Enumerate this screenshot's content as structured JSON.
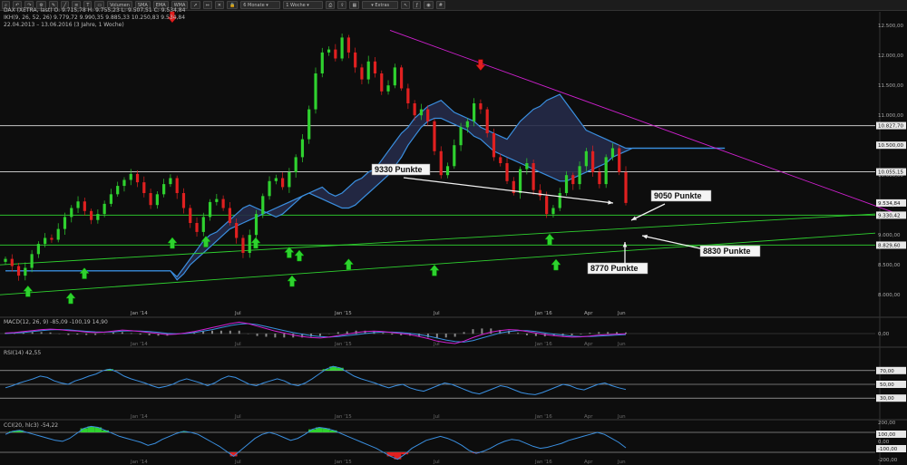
{
  "toolbar": {
    "buttons": [
      "Volumen",
      "SMA",
      "EMA",
      "WMA"
    ],
    "period_select": "6 Monate",
    "interval_select": "1 Woche",
    "extras_label": "Extras",
    "icons": [
      "zoom-icon",
      "undo-icon",
      "redo-icon",
      "settings-icon",
      "pencil-icon",
      "line-icon",
      "fib-icon",
      "text-icon",
      "shape-icon",
      "arrow-icon",
      "measure-icon",
      "delete-icon",
      "lock-icon",
      "print-icon",
      "export-icon",
      "layout-icon",
      "pointer-icon",
      "indicator-icon",
      "camera-icon",
      "grid-icon"
    ]
  },
  "info": {
    "line1": "DAX (XETRA, last)  O: 9.715,78  H: 9.755,23  L: 9.507,51  C: 9.534,84",
    "line2": "IKH(9, 26, 52, 26)  9.779,72  9.990,35  9.885,33  10.250,83  9.534,84",
    "line3": "22.04.2013 – 13.06.2016 (3 Jahre, 1 Woche)"
  },
  "colors": {
    "background": "#0d0d0d",
    "bull": "#2fd12f",
    "bear": "#e02020",
    "cloud_line": "#3a8fe0",
    "cloud_fill": "#252a48",
    "support": "#2fd12f",
    "resistance_trend": "#d020d0",
    "horizontal": "#d8d8d8",
    "macd_line": "#d020d0",
    "macd_signal": "#3a8fe0",
    "oscillator": "#3a8fe0"
  },
  "chart_data": [
    {
      "type": "candlestick",
      "title": "",
      "y_ticks": [
        8000,
        8500,
        9000,
        9500,
        10000,
        10500,
        11000,
        11500,
        12000,
        12500
      ],
      "x_ticks": [
        "Jan '14",
        "Jul",
        "Jan '15",
        "Jul",
        "Jan '16",
        "Apr",
        "Jun"
      ],
      "ylim": [
        7700,
        12700
      ],
      "price_boxes": [
        {
          "label": "10.827,70",
          "value": 10827.7
        },
        {
          "label": "10.500,00",
          "value": 10500
        },
        {
          "label": "10.055,15",
          "value": 10055.15
        },
        {
          "label": "9.534,84",
          "value": 9534.84
        },
        {
          "label": "9.330,42",
          "value": 9330.42
        },
        {
          "label": "8.829,60",
          "value": 8829.6
        }
      ],
      "horizontal_lines": [
        10827.7,
        10055.15,
        9330,
        8830
      ],
      "close_series": [
        8600,
        8480,
        8320,
        8450,
        8680,
        8850,
        8950,
        8920,
        9100,
        9300,
        9450,
        9560,
        9400,
        9250,
        9350,
        9520,
        9680,
        9820,
        9920,
        10020,
        9880,
        9700,
        9500,
        9680,
        9850,
        9950,
        9700,
        9450,
        9200,
        9050,
        9300,
        9550,
        9600,
        9450,
        9200,
        8950,
        8700,
        9000,
        9350,
        9650,
        9900,
        9950,
        9800,
        10050,
        10300,
        10600,
        11100,
        11700,
        12050,
        12100,
        11950,
        12300,
        12050,
        11800,
        11600,
        11900,
        11700,
        11400,
        11500,
        11800,
        11450,
        11200,
        11000,
        11100,
        10900,
        10400,
        10000,
        10150,
        10500,
        10800,
        10900,
        11200,
        11100,
        10700,
        10300,
        10200,
        9900,
        9700,
        10100,
        10200,
        9750,
        9650,
        9350,
        9450,
        9700,
        10000,
        9850,
        10150,
        10400,
        10050,
        9850,
        10300,
        10450,
        10050,
        9534.84
      ],
      "cloud": {
        "span_a": [
          8400,
          8400,
          8400,
          8400,
          8400,
          8400,
          8400,
          8400,
          8400,
          8400,
          8400,
          8400,
          8400,
          8400,
          8400,
          8400,
          8400,
          8400,
          8400,
          8400,
          8400,
          8400,
          8400,
          8400,
          8400,
          8400,
          8300,
          8450,
          8600,
          8750,
          8900,
          9000,
          9050,
          9150,
          9250,
          9350,
          9450,
          9500,
          9450,
          9400,
          9350,
          9300,
          9350,
          9450,
          9550,
          9650,
          9700,
          9750,
          9800,
          9700,
          9650,
          9700,
          9800,
          9900,
          9950,
          10050,
          10100,
          10250,
          10400,
          10550,
          10700,
          10800,
          10950,
          11050,
          11150,
          11200,
          11250,
          11150,
          11050,
          11000,
          10950,
          10900,
          10800,
          10750,
          10700,
          10650,
          10600,
          10750,
          10900,
          11000,
          11100,
          11150,
          11250,
          11300,
          11350,
          11200,
          11050,
          10900,
          10750,
          10700,
          10650,
          10600,
          10550,
          10500,
          10450,
          10450,
          10450,
          10450,
          10450,
          10450,
          10450,
          10450,
          10450,
          10450,
          10450,
          10450,
          10450,
          10450,
          10450,
          10450,
          10450,
          10450,
          10450,
          10450,
          10450,
          10450,
          10450,
          10450,
          10450,
          10450,
          10450
        ],
        "span_b": [
          8400,
          8400,
          8400,
          8400,
          8400,
          8400,
          8400,
          8400,
          8400,
          8400,
          8400,
          8400,
          8400,
          8400,
          8400,
          8400,
          8400,
          8400,
          8400,
          8400,
          8400,
          8400,
          8400,
          8400,
          8400,
          8400,
          8250,
          8350,
          8500,
          8600,
          8700,
          8800,
          8900,
          9000,
          9100,
          9150,
          9200,
          9250,
          9300,
          9350,
          9400,
          9450,
          9500,
          9550,
          9600,
          9650,
          9700,
          9650,
          9600,
          9550,
          9500,
          9450,
          9450,
          9500,
          9600,
          9700,
          9800,
          9900,
          10000,
          10150,
          10300,
          10500,
          10650,
          10800,
          10900,
          10950,
          10950,
          10900,
          10850,
          10800,
          10750,
          10650,
          10600,
          10500,
          10400,
          10350,
          10300,
          10250,
          10200,
          10150,
          10100,
          10050,
          10000,
          9950,
          9900,
          9900,
          9950,
          10000,
          10050,
          10100,
          10150,
          10200,
          10300,
          10350,
          10400,
          10450,
          10450,
          10450,
          10450,
          10450,
          10450,
          10450,
          10450,
          10450,
          10450,
          10450,
          10450,
          10450,
          10450,
          10450,
          10450,
          10450,
          10450,
          10450,
          10450,
          10450,
          10450,
          10450,
          10450,
          10450,
          10450
        ]
      },
      "up_arrows": [
        {
          "i": 3,
          "price": 8150
        },
        {
          "i": 11,
          "price": 8450
        },
        {
          "i": 29,
          "price": 8980
        },
        {
          "i": 43,
          "price": 8800
        },
        {
          "i": 52,
          "price": 8600
        },
        {
          "i": 65,
          "price": 8500
        }
      ],
      "down_arrows": [
        {
          "i": 25,
          "price": 12550
        },
        {
          "i": 72,
          "price": 11750
        }
      ],
      "annotations": [
        {
          "text": "9330 Punkte",
          "price": 9820
        },
        {
          "text": "9050 Punkte",
          "price": 9390
        },
        {
          "text": "8830 Punkte",
          "price": 8630
        },
        {
          "text": "8770 Punkte",
          "price": 8470
        }
      ]
    },
    {
      "type": "line",
      "title": "MACD(12, 26, 9)  -85,09  -100,19  14,90",
      "y_ticks": [
        "0,00"
      ],
      "series": [
        {
          "name": "MACD",
          "values": [
            10,
            20,
            40,
            60,
            80,
            90,
            80,
            60,
            50,
            30,
            20,
            30,
            50,
            70,
            60,
            40,
            20,
            0,
            -20,
            -10,
            10,
            40,
            80,
            120,
            160,
            200,
            230,
            200,
            150,
            100,
            50,
            10,
            -30,
            -60,
            -80,
            -90,
            -70,
            -40,
            -10,
            20,
            40,
            50,
            40,
            20,
            0,
            -20,
            -60,
            -100,
            -150,
            -180,
            -200,
            -150,
            -80,
            -20,
            30,
            60,
            80,
            70,
            40,
            10,
            -20,
            -40,
            -60,
            -70,
            -65,
            -50,
            -30,
            -20,
            -10,
            -5
          ]
        },
        {
          "name": "Signal",
          "values": [
            0,
            10,
            20,
            40,
            60,
            75,
            80,
            75,
            60,
            45,
            35,
            30,
            35,
            50,
            55,
            50,
            40,
            25,
            5,
            -5,
            0,
            20,
            50,
            80,
            120,
            160,
            190,
            200,
            180,
            140,
            100,
            60,
            20,
            -10,
            -40,
            -60,
            -70,
            -60,
            -40,
            -20,
            0,
            20,
            30,
            30,
            20,
            5,
            -20,
            -50,
            -90,
            -130,
            -160,
            -170,
            -140,
            -90,
            -40,
            10,
            40,
            60,
            60,
            40,
            15,
            -10,
            -30,
            -50,
            -60,
            -60,
            -50,
            -40,
            -30,
            -20
          ]
        }
      ]
    },
    {
      "type": "line",
      "title": "RSI(14)  42,55",
      "y_ticks": [
        "70,00",
        "50,00",
        "30,00"
      ],
      "ylim": [
        0,
        100
      ],
      "values": [
        45,
        48,
        52,
        55,
        58,
        62,
        60,
        55,
        52,
        50,
        55,
        58,
        62,
        65,
        70,
        72,
        68,
        62,
        58,
        55,
        52,
        48,
        45,
        47,
        50,
        55,
        58,
        55,
        52,
        48,
        52,
        58,
        62,
        60,
        55,
        50,
        48,
        52,
        55,
        58,
        55,
        50,
        48,
        52,
        58,
        65,
        72,
        76,
        74,
        68,
        62,
        58,
        55,
        52,
        48,
        45,
        48,
        50,
        45,
        42,
        40,
        44,
        48,
        52,
        50,
        46,
        42,
        38,
        36,
        40,
        44,
        48,
        46,
        42,
        38,
        36,
        35,
        38,
        42,
        46,
        50,
        48,
        44,
        42,
        46,
        50,
        52,
        48,
        45,
        42.55
      ]
    },
    {
      "type": "line",
      "title": "CCI(20, hlc3)  -54,22",
      "y_ticks": [
        "200,00",
        "100,00",
        "0,00",
        "-100,00",
        "-200,00"
      ],
      "ylim": [
        -220,
        220
      ],
      "values": [
        80,
        110,
        120,
        100,
        80,
        60,
        40,
        20,
        10,
        40,
        90,
        140,
        160,
        150,
        120,
        90,
        60,
        40,
        20,
        0,
        -30,
        -10,
        30,
        60,
        90,
        110,
        100,
        80,
        40,
        0,
        -40,
        -90,
        -140,
        -80,
        -20,
        40,
        80,
        100,
        80,
        50,
        20,
        40,
        80,
        130,
        150,
        140,
        120,
        90,
        60,
        30,
        0,
        -30,
        -60,
        -100,
        -140,
        -170,
        -120,
        -60,
        -20,
        20,
        40,
        60,
        40,
        10,
        -30,
        -80,
        -110,
        -90,
        -60,
        -20,
        10,
        30,
        20,
        -10,
        -40,
        -60,
        -50,
        -30,
        -10,
        20,
        40,
        60,
        80,
        100,
        80,
        40,
        0,
        -54.22
      ]
    }
  ]
}
